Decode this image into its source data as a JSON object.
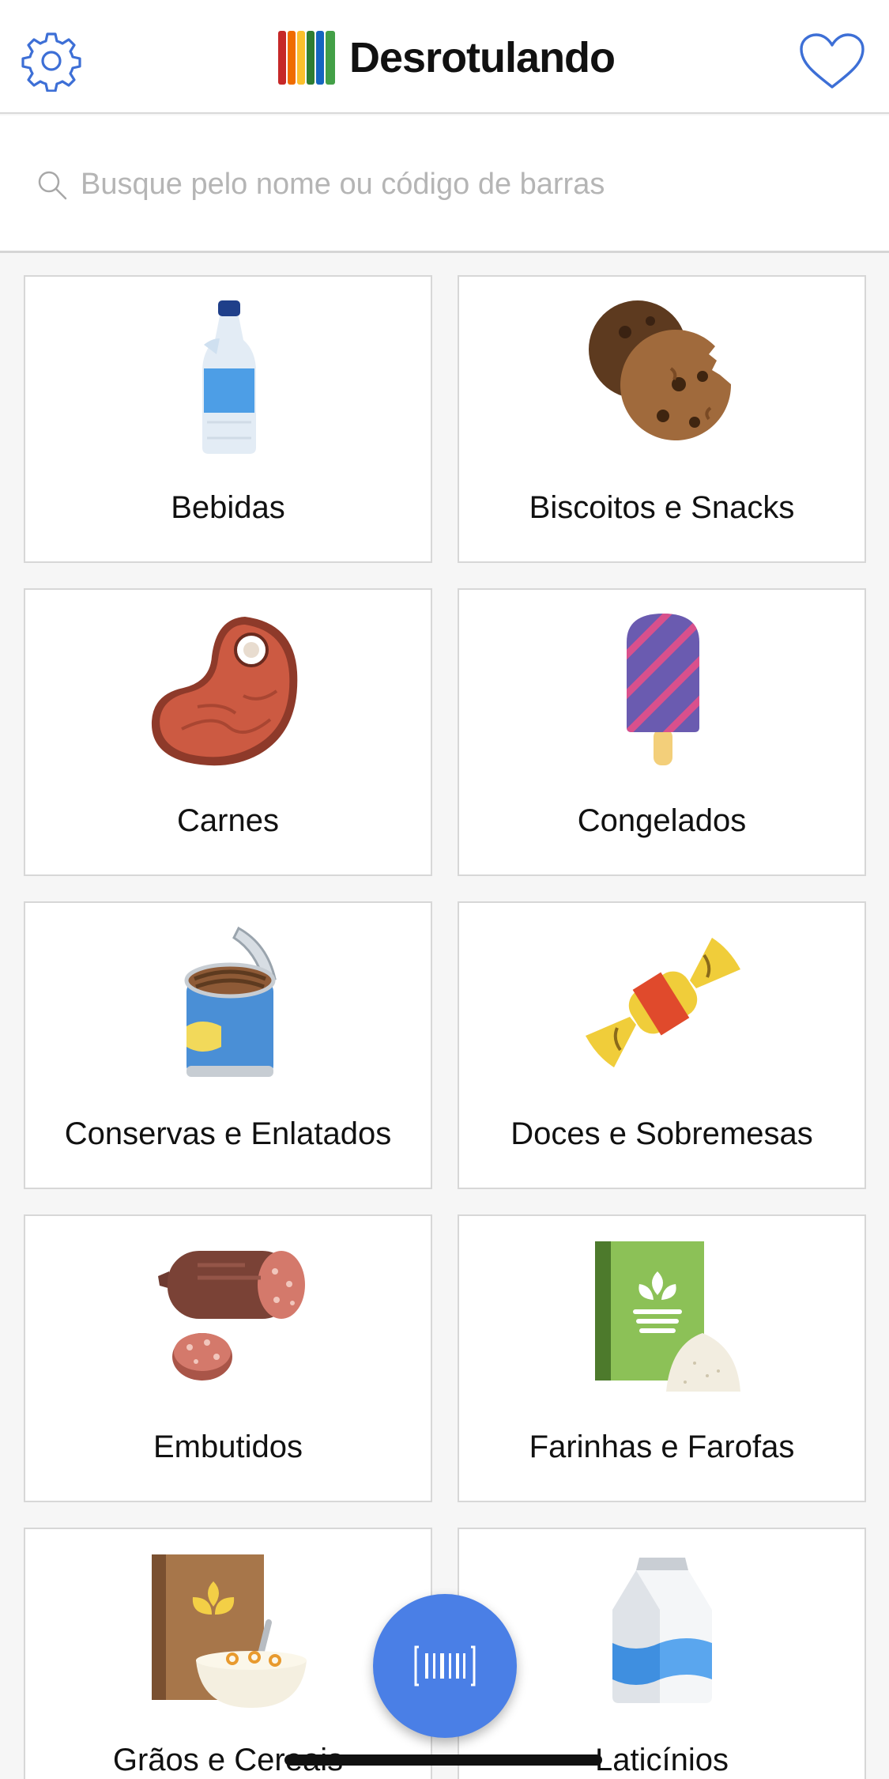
{
  "header": {
    "app_name": "Desrotulando",
    "settings_icon": "gear-icon",
    "favorites_icon": "heart-icon",
    "accent_color": "#3d6fd6"
  },
  "search": {
    "placeholder": "Busque pelo nome ou código de barras",
    "value": "",
    "icon": "search-icon"
  },
  "categories": [
    {
      "label": "Bebidas",
      "icon": "water-bottle-icon"
    },
    {
      "label": "Biscoitos e Snacks",
      "icon": "cookies-icon"
    },
    {
      "label": "Carnes",
      "icon": "steak-icon"
    },
    {
      "label": "Congelados",
      "icon": "popsicle-icon"
    },
    {
      "label": "Conservas e Enlatados",
      "icon": "canned-food-icon"
    },
    {
      "label": "Doces e Sobremesas",
      "icon": "candy-icon"
    },
    {
      "label": "Embutidos",
      "icon": "salami-icon"
    },
    {
      "label": "Farinhas e Farofas",
      "icon": "flour-icon"
    },
    {
      "label": "Grãos e Cereais",
      "icon": "cereal-box-icon"
    },
    {
      "label": "Laticínios",
      "icon": "milk-carton-icon"
    }
  ],
  "scan_button": {
    "icon": "barcode-icon",
    "color": "#4a7fe6"
  }
}
